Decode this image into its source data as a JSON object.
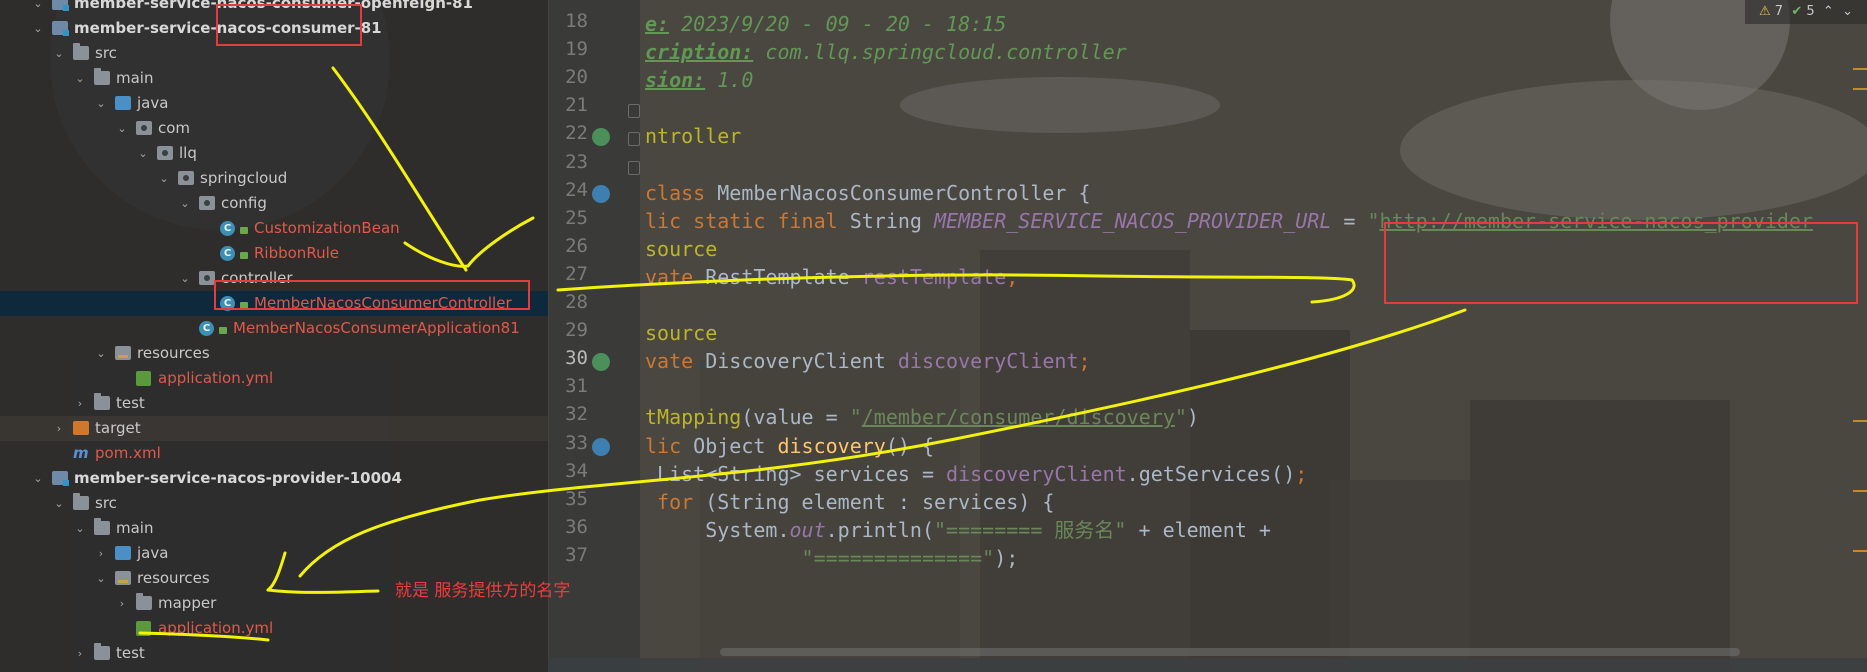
{
  "project_tree": {
    "rows": [
      {
        "indent": 1,
        "chevron": "expanded",
        "icon": "module-folder-icon",
        "label": "member-service-nacos-consumer-openfeign-81",
        "style": "bold",
        "partial": true
      },
      {
        "indent": 1,
        "chevron": "expanded",
        "icon": "module-folder-icon",
        "label": "member-service-nacos-consumer-81",
        "style": "bold"
      },
      {
        "indent": 2,
        "chevron": "expanded",
        "icon": "folder-icon",
        "label": "src",
        "style": "normal"
      },
      {
        "indent": 3,
        "chevron": "expanded",
        "icon": "folder-icon",
        "label": "main",
        "style": "normal"
      },
      {
        "indent": 4,
        "chevron": "expanded",
        "icon": "source-folder-icon",
        "label": "java",
        "style": "normal"
      },
      {
        "indent": 5,
        "chevron": "expanded",
        "icon": "package-icon",
        "label": "com",
        "style": "normal"
      },
      {
        "indent": 6,
        "chevron": "expanded",
        "icon": "package-icon",
        "label": "llq",
        "style": "normal"
      },
      {
        "indent": 7,
        "chevron": "expanded",
        "icon": "package-icon",
        "label": "springcloud",
        "style": "normal"
      },
      {
        "indent": 8,
        "chevron": "expanded",
        "icon": "package-icon",
        "label": "config",
        "style": "normal"
      },
      {
        "indent": 9,
        "chevron": "none",
        "icon": "class-icon",
        "label": "CustomizationBean",
        "style": "red"
      },
      {
        "indent": 9,
        "chevron": "none",
        "icon": "class-icon",
        "label": "RibbonRule",
        "style": "red"
      },
      {
        "indent": 8,
        "chevron": "expanded",
        "icon": "package-icon",
        "label": "controller",
        "style": "normal"
      },
      {
        "indent": 9,
        "chevron": "none",
        "icon": "class-icon",
        "label": "MemberNacosConsumerController",
        "style": "red",
        "selected": true
      },
      {
        "indent": 8,
        "chevron": "none",
        "icon": "spring-class-icon",
        "label": "MemberNacosConsumerApplication81",
        "style": "red"
      },
      {
        "indent": 4,
        "chevron": "expanded",
        "icon": "resources-folder-icon",
        "label": "resources",
        "style": "normal"
      },
      {
        "indent": 5,
        "chevron": "none",
        "icon": "yaml-icon",
        "label": "application.yml",
        "style": "red"
      },
      {
        "indent": 3,
        "chevron": "collapsed",
        "icon": "folder-icon",
        "label": "test",
        "style": "normal"
      },
      {
        "indent": 2,
        "chevron": "collapsed",
        "icon": "target-folder-icon",
        "label": "target",
        "style": "normal",
        "highlight": true
      },
      {
        "indent": 2,
        "chevron": "none",
        "icon": "maven-icon",
        "label": "pom.xml",
        "style": "red"
      },
      {
        "indent": 1,
        "chevron": "expanded",
        "icon": "module-folder-icon",
        "label": "member-service-nacos-provider-10004",
        "style": "bold"
      },
      {
        "indent": 2,
        "chevron": "expanded",
        "icon": "folder-icon",
        "label": "src",
        "style": "normal"
      },
      {
        "indent": 3,
        "chevron": "expanded",
        "icon": "folder-icon",
        "label": "main",
        "style": "normal"
      },
      {
        "indent": 4,
        "chevron": "collapsed",
        "icon": "source-folder-icon",
        "label": "java",
        "style": "normal"
      },
      {
        "indent": 4,
        "chevron": "expanded",
        "icon": "resources-folder-icon",
        "label": "resources",
        "style": "normal"
      },
      {
        "indent": 5,
        "chevron": "collapsed",
        "icon": "folder-icon",
        "label": "mapper",
        "style": "normal"
      },
      {
        "indent": 5,
        "chevron": "none",
        "icon": "yaml-icon",
        "label": "application.yml",
        "style": "red"
      },
      {
        "indent": 3,
        "chevron": "collapsed",
        "icon": "folder-icon",
        "label": "test",
        "style": "normal"
      }
    ]
  },
  "editor": {
    "current_line": "30",
    "lines": [
      {
        "num": "18",
        "tokens": [
          {
            "t": "e:",
            "c": "cmtk"
          },
          {
            "t": " 2023/9/20 - 09 - 20 - 18:15",
            "c": "cmt"
          }
        ]
      },
      {
        "num": "19",
        "tokens": [
          {
            "t": "cription:",
            "c": "cmtk"
          },
          {
            "t": " com.llq.springcloud.controller",
            "c": "cmt"
          }
        ]
      },
      {
        "num": "20",
        "tokens": [
          {
            "t": "sion:",
            "c": "cmtk"
          },
          {
            "t": " 1.0",
            "c": "cmt"
          }
        ]
      },
      {
        "num": "21",
        "tokens": []
      },
      {
        "num": "22",
        "tokens": [
          {
            "t": "ntroller",
            "c": "ann"
          }
        ]
      },
      {
        "num": "23",
        "tokens": []
      },
      {
        "num": "24",
        "tokens": [
          {
            "t": "class ",
            "c": "kw"
          },
          {
            "t": "MemberNacosConsumerController {",
            "c": "plain"
          }
        ]
      },
      {
        "num": "25",
        "tokens": [
          {
            "t": "lic static final ",
            "c": "kw"
          },
          {
            "t": "String ",
            "c": "plain"
          },
          {
            "t": "MEMBER_SERVICE_NACOS_PROVIDER_URL",
            "c": "fld"
          },
          {
            "t": " = ",
            "c": "plain"
          },
          {
            "t": "\"",
            "c": "str"
          },
          {
            "t": "http://member-service-nacos_provider",
            "c": "url"
          }
        ]
      },
      {
        "num": "26",
        "tokens": [
          {
            "t": "source",
            "c": "ann"
          }
        ]
      },
      {
        "num": "27",
        "tokens": [
          {
            "t": "vate ",
            "c": "kw"
          },
          {
            "t": "RestTemplate ",
            "c": "plain"
          },
          {
            "t": "restTemplate",
            "c": "fld2"
          },
          {
            "t": ";",
            "c": "kw"
          }
        ]
      },
      {
        "num": "28",
        "tokens": []
      },
      {
        "num": "29",
        "tokens": [
          {
            "t": "source",
            "c": "ann"
          }
        ]
      },
      {
        "num": "30",
        "tokens": [
          {
            "t": "vate ",
            "c": "kw"
          },
          {
            "t": "DiscoveryClient ",
            "c": "plain"
          },
          {
            "t": "discoveryClient",
            "c": "fld2"
          },
          {
            "t": ";",
            "c": "kw"
          }
        ]
      },
      {
        "num": "31",
        "tokens": []
      },
      {
        "num": "32",
        "tokens": [
          {
            "t": "tMapping",
            "c": "ann"
          },
          {
            "t": "(value = ",
            "c": "plain"
          },
          {
            "t": "\"",
            "c": "str"
          },
          {
            "t": "/member/consumer/discovery",
            "c": "url"
          },
          {
            "t": "\"",
            "c": "str"
          },
          {
            "t": ")",
            "c": "plain"
          }
        ]
      },
      {
        "num": "33",
        "tokens": [
          {
            "t": "lic ",
            "c": "kw"
          },
          {
            "t": "Object ",
            "c": "plain"
          },
          {
            "t": "discovery",
            "c": "fn"
          },
          {
            "t": "() {",
            "c": "plain"
          }
        ]
      },
      {
        "num": "34",
        "tokens": [
          {
            "t": " List<String> services = ",
            "c": "plain"
          },
          {
            "t": "discoveryClient",
            "c": "fld2"
          },
          {
            "t": ".getServices()",
            "c": "plain"
          },
          {
            "t": ";",
            "c": "kw"
          }
        ]
      },
      {
        "num": "35",
        "tokens": [
          {
            "t": " for ",
            "c": "kw"
          },
          {
            "t": "(String element : services) {",
            "c": "plain"
          }
        ]
      },
      {
        "num": "36",
        "tokens": [
          {
            "t": "     System.",
            "c": "plain"
          },
          {
            "t": "out",
            "c": "fld"
          },
          {
            "t": ".println(",
            "c": "plain"
          },
          {
            "t": "\"======== 服务名\"",
            "c": "str"
          },
          {
            "t": " + element +",
            "c": "plain"
          }
        ]
      },
      {
        "num": "37",
        "tokens": [
          {
            "t": "             \"",
            "c": "str"
          },
          {
            "t": "==============\"",
            "c": "str"
          },
          {
            "t": ");",
            "c": "plain"
          }
        ]
      }
    ]
  },
  "inspection": {
    "warnings": "7",
    "weak_warnings": "5",
    "up": "⌃",
    "down": "⌄"
  },
  "annotation": {
    "note": "就是 服务提供方的名字"
  },
  "colors": {
    "accent_red": "#e43b3b",
    "ink_yellow": "#f2f20a",
    "selection": "#0d293e"
  }
}
